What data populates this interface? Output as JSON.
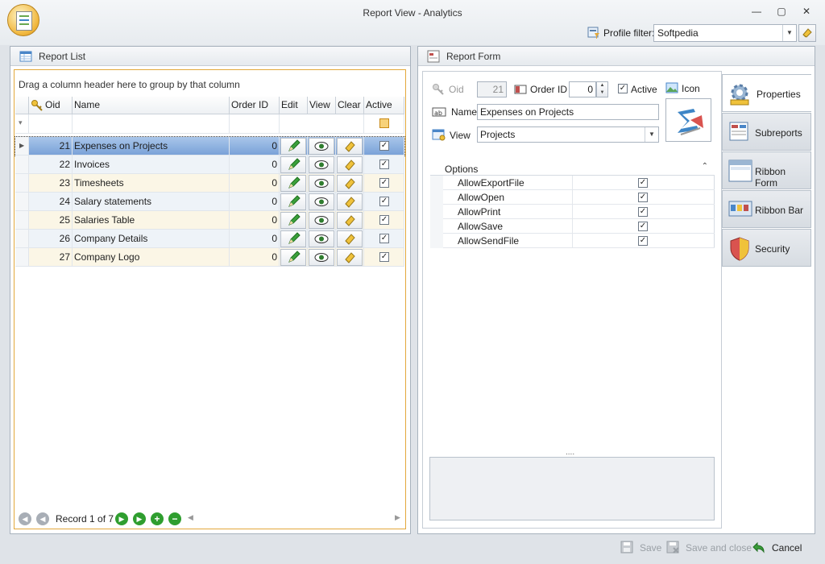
{
  "window": {
    "title": "Report View - Analytics",
    "controls": [
      "—",
      "▢",
      "✕"
    ]
  },
  "profile_filter": {
    "label": "Profile filter:",
    "value": "Softpedia"
  },
  "report_list": {
    "title": "Report List",
    "group_hint": "Drag a column header here to group by that column",
    "columns": [
      "Oid",
      "Name",
      "Order ID",
      "Edit",
      "View",
      "Clear",
      "Active"
    ],
    "rows": [
      {
        "oid": "21",
        "name": "Expenses on Projects",
        "order_id": "0",
        "active": true
      },
      {
        "oid": "22",
        "name": "Invoices",
        "order_id": "0",
        "active": true
      },
      {
        "oid": "23",
        "name": "Timesheets",
        "order_id": "0",
        "active": true
      },
      {
        "oid": "24",
        "name": "Salary statements",
        "order_id": "0",
        "active": true
      },
      {
        "oid": "25",
        "name": "Salaries Table",
        "order_id": "0",
        "active": true
      },
      {
        "oid": "26",
        "name": "Company Details",
        "order_id": "0",
        "active": true
      },
      {
        "oid": "27",
        "name": "Company Logo",
        "order_id": "0",
        "active": true
      }
    ],
    "navigator": {
      "record_text": "Record 1 of 7"
    }
  },
  "report_form": {
    "title": "Report Form",
    "oid_label": "Oid",
    "oid_value": "21",
    "order_id_label": "Order ID",
    "order_id_value": "0",
    "active_label": "Active",
    "active_checked": true,
    "icon_label": "Icon",
    "name_label": "Name",
    "name_value": "Expenses on Projects",
    "view_label": "View",
    "view_value": "Projects",
    "options_header": "Options",
    "options": [
      {
        "name": "AllowExportFile",
        "checked": true
      },
      {
        "name": "AllowOpen",
        "checked": true
      },
      {
        "name": "AllowPrint",
        "checked": true
      },
      {
        "name": "AllowSave",
        "checked": true
      },
      {
        "name": "AllowSendFile",
        "checked": true
      }
    ],
    "splitter": "....",
    "tabs": [
      "Properties",
      "Subreports",
      "Ribbon Form",
      "Ribbon Bar",
      "Security"
    ]
  },
  "footer": {
    "save": "Save",
    "save_close": "Save and close",
    "cancel": "Cancel"
  },
  "colors": {
    "selection": "#7aa2d8",
    "focus_border": "#e3a83b",
    "nav_green": "#2f9e2f"
  }
}
